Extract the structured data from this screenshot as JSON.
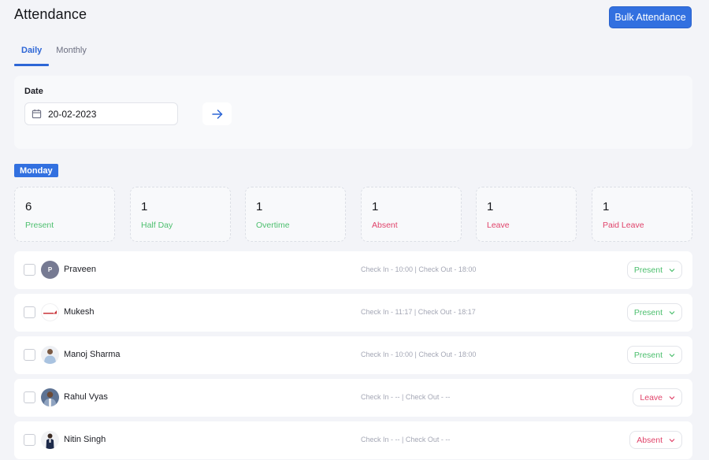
{
  "header": {
    "title": "Attendance",
    "bulk_button": "Bulk Attendance"
  },
  "tabs": [
    {
      "label": "Daily",
      "active": true
    },
    {
      "label": "Monthly",
      "active": false
    }
  ],
  "filter": {
    "date_label": "Date",
    "date_value": "20-02-2023",
    "date_icon": "calendar-icon",
    "go_icon": "arrow-right-icon"
  },
  "day_badge": "Monday",
  "stats": [
    {
      "value": "6",
      "label": "Present",
      "tone": "green"
    },
    {
      "value": "1",
      "label": "Half Day",
      "tone": "green"
    },
    {
      "value": "1",
      "label": "Overtime",
      "tone": "green"
    },
    {
      "value": "1",
      "label": "Absent",
      "tone": "red"
    },
    {
      "value": "1",
      "label": "Leave",
      "tone": "red"
    },
    {
      "value": "1",
      "label": "Paid Leave",
      "tone": "red"
    }
  ],
  "employees": [
    {
      "name": "Praveen",
      "avatar": "P",
      "avatar_type": "initial",
      "times": "Check In - 10:00 | Check Out - 18:00",
      "status": "Present",
      "tone": "green"
    },
    {
      "name": "Mukesh",
      "avatar": "",
      "avatar_type": "logo",
      "times": "Check In - 11:17 | Check Out - 18:17",
      "status": "Present",
      "tone": "green"
    },
    {
      "name": "Manoj Sharma",
      "avatar": "",
      "avatar_type": "photo-light",
      "times": "Check In - 10:00 | Check Out - 18:00",
      "status": "Present",
      "tone": "green"
    },
    {
      "name": "Rahul Vyas",
      "avatar": "",
      "avatar_type": "photo-dark",
      "times": "Check In - -- | Check Out - --",
      "status": "Leave",
      "tone": "red"
    },
    {
      "name": "Nitin Singh",
      "avatar": "",
      "avatar_type": "photo-white",
      "times": "Check In - -- | Check Out - --",
      "status": "Absent",
      "tone": "red"
    }
  ],
  "colors": {
    "primary": "#3270e0",
    "present": "#4cbf6e",
    "absent": "#e0436a",
    "background": "#f3f4f8"
  }
}
